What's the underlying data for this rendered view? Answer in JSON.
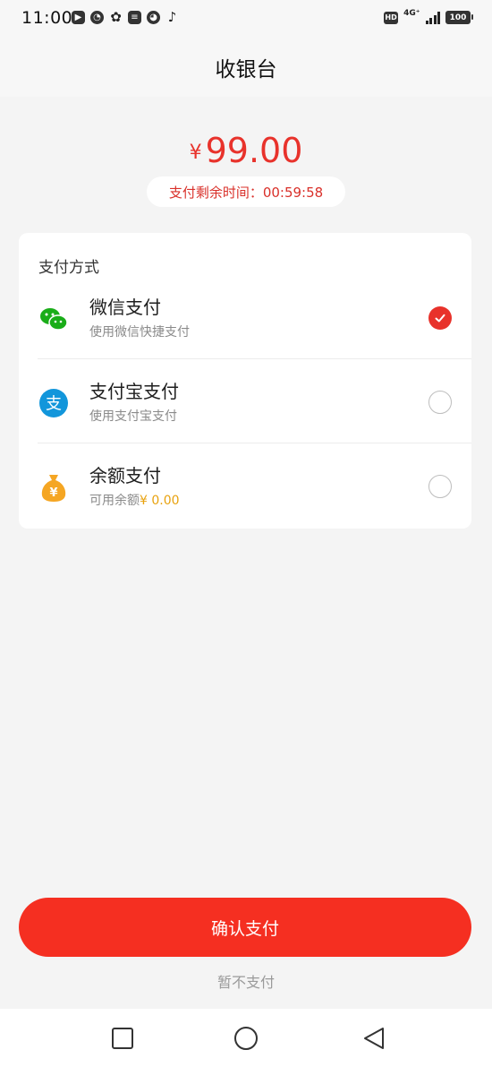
{
  "status_bar": {
    "time": "11:00",
    "hd": "HD",
    "network": "4G⁺",
    "battery": "100"
  },
  "header": {
    "title": "收银台"
  },
  "amount": {
    "currency": "¥",
    "value": "99.00"
  },
  "countdown": {
    "text": "支付剩余时间：00:59:58"
  },
  "payment": {
    "section_title": "支付方式",
    "methods": [
      {
        "name": "微信支付",
        "desc": "使用微信快捷支付",
        "selected": true,
        "icon": "wechat-pay-icon",
        "color": "#1aad19"
      },
      {
        "name": "支付宝支付",
        "desc": "使用支付宝支付",
        "selected": false,
        "icon": "alipay-icon",
        "color": "#1296db"
      },
      {
        "name": "余额支付",
        "desc": "可用余额",
        "balance": "¥ 0.00",
        "selected": false,
        "icon": "money-bag-icon",
        "color": "#f5a623"
      }
    ]
  },
  "actions": {
    "confirm_label": "确认支付",
    "skip_label": "暂不支付"
  },
  "colors": {
    "accent": "#f52f21",
    "price": "#e8322b",
    "balance": "#e8a20f"
  }
}
